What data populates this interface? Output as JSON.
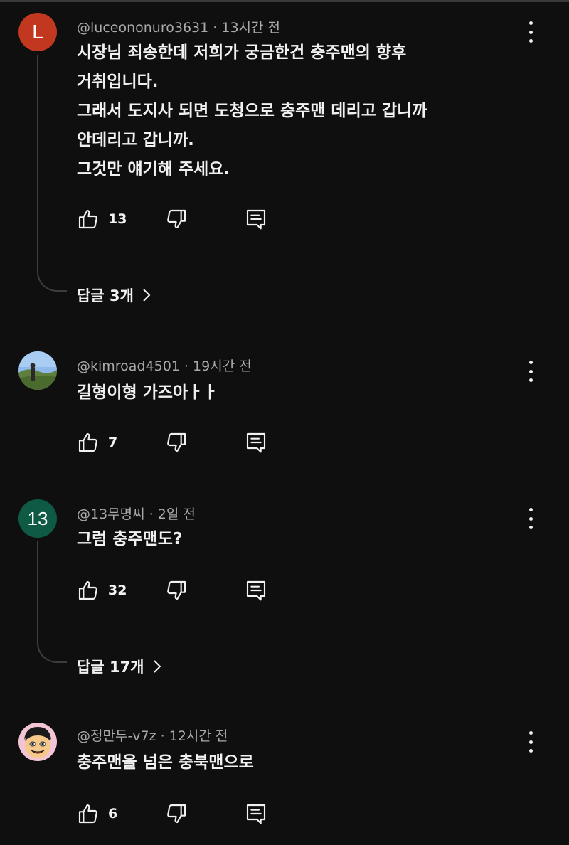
{
  "comments": [
    {
      "avatar_letter": "L",
      "avatar_color": "#c1371f",
      "handle": "@luceononuro3631",
      "time": "13시간 전",
      "lines": [
        "시장님 죄송한데 저희가 궁금한건 충주맨의 향후",
        "거취입니다.",
        "그래서 도지사 되면 도청으로 충주맨 데리고 갑니까",
        "안데리고 갑니까.",
        "그것만 얘기해 주세요."
      ],
      "likes": "13",
      "replies_label": "답글 3개"
    },
    {
      "avatar_image": "landscape-photo",
      "handle": "@kimroad4501",
      "time": "19시간 전",
      "lines": [
        "길형이형 가즈아ㅏㅏ"
      ],
      "likes": "7"
    },
    {
      "avatar_letter": "13",
      "avatar_color": "#0f5a45",
      "handle": "@13무명씨",
      "time": "2일 전",
      "lines": [
        "그럼 충주맨도?"
      ],
      "likes": "32",
      "replies_label": "답글 17개"
    },
    {
      "avatar_image": "cartoon-face",
      "handle": "@정만두-v7z",
      "time": "12시간 전",
      "lines": [
        "충주맨을 넘은 충북맨으로"
      ],
      "likes": "6"
    }
  ],
  "icons": {
    "like": "thumbs-up-icon",
    "dislike": "thumbs-down-icon",
    "reply": "reply-icon",
    "more": "more-vert-icon",
    "replies_chevron": "chevron-right-icon"
  },
  "colors": {
    "background": "#0f0f0f",
    "text": "#f1f1f1",
    "meta": "#aaaaaa",
    "thread_line": "#3d3d3d"
  }
}
